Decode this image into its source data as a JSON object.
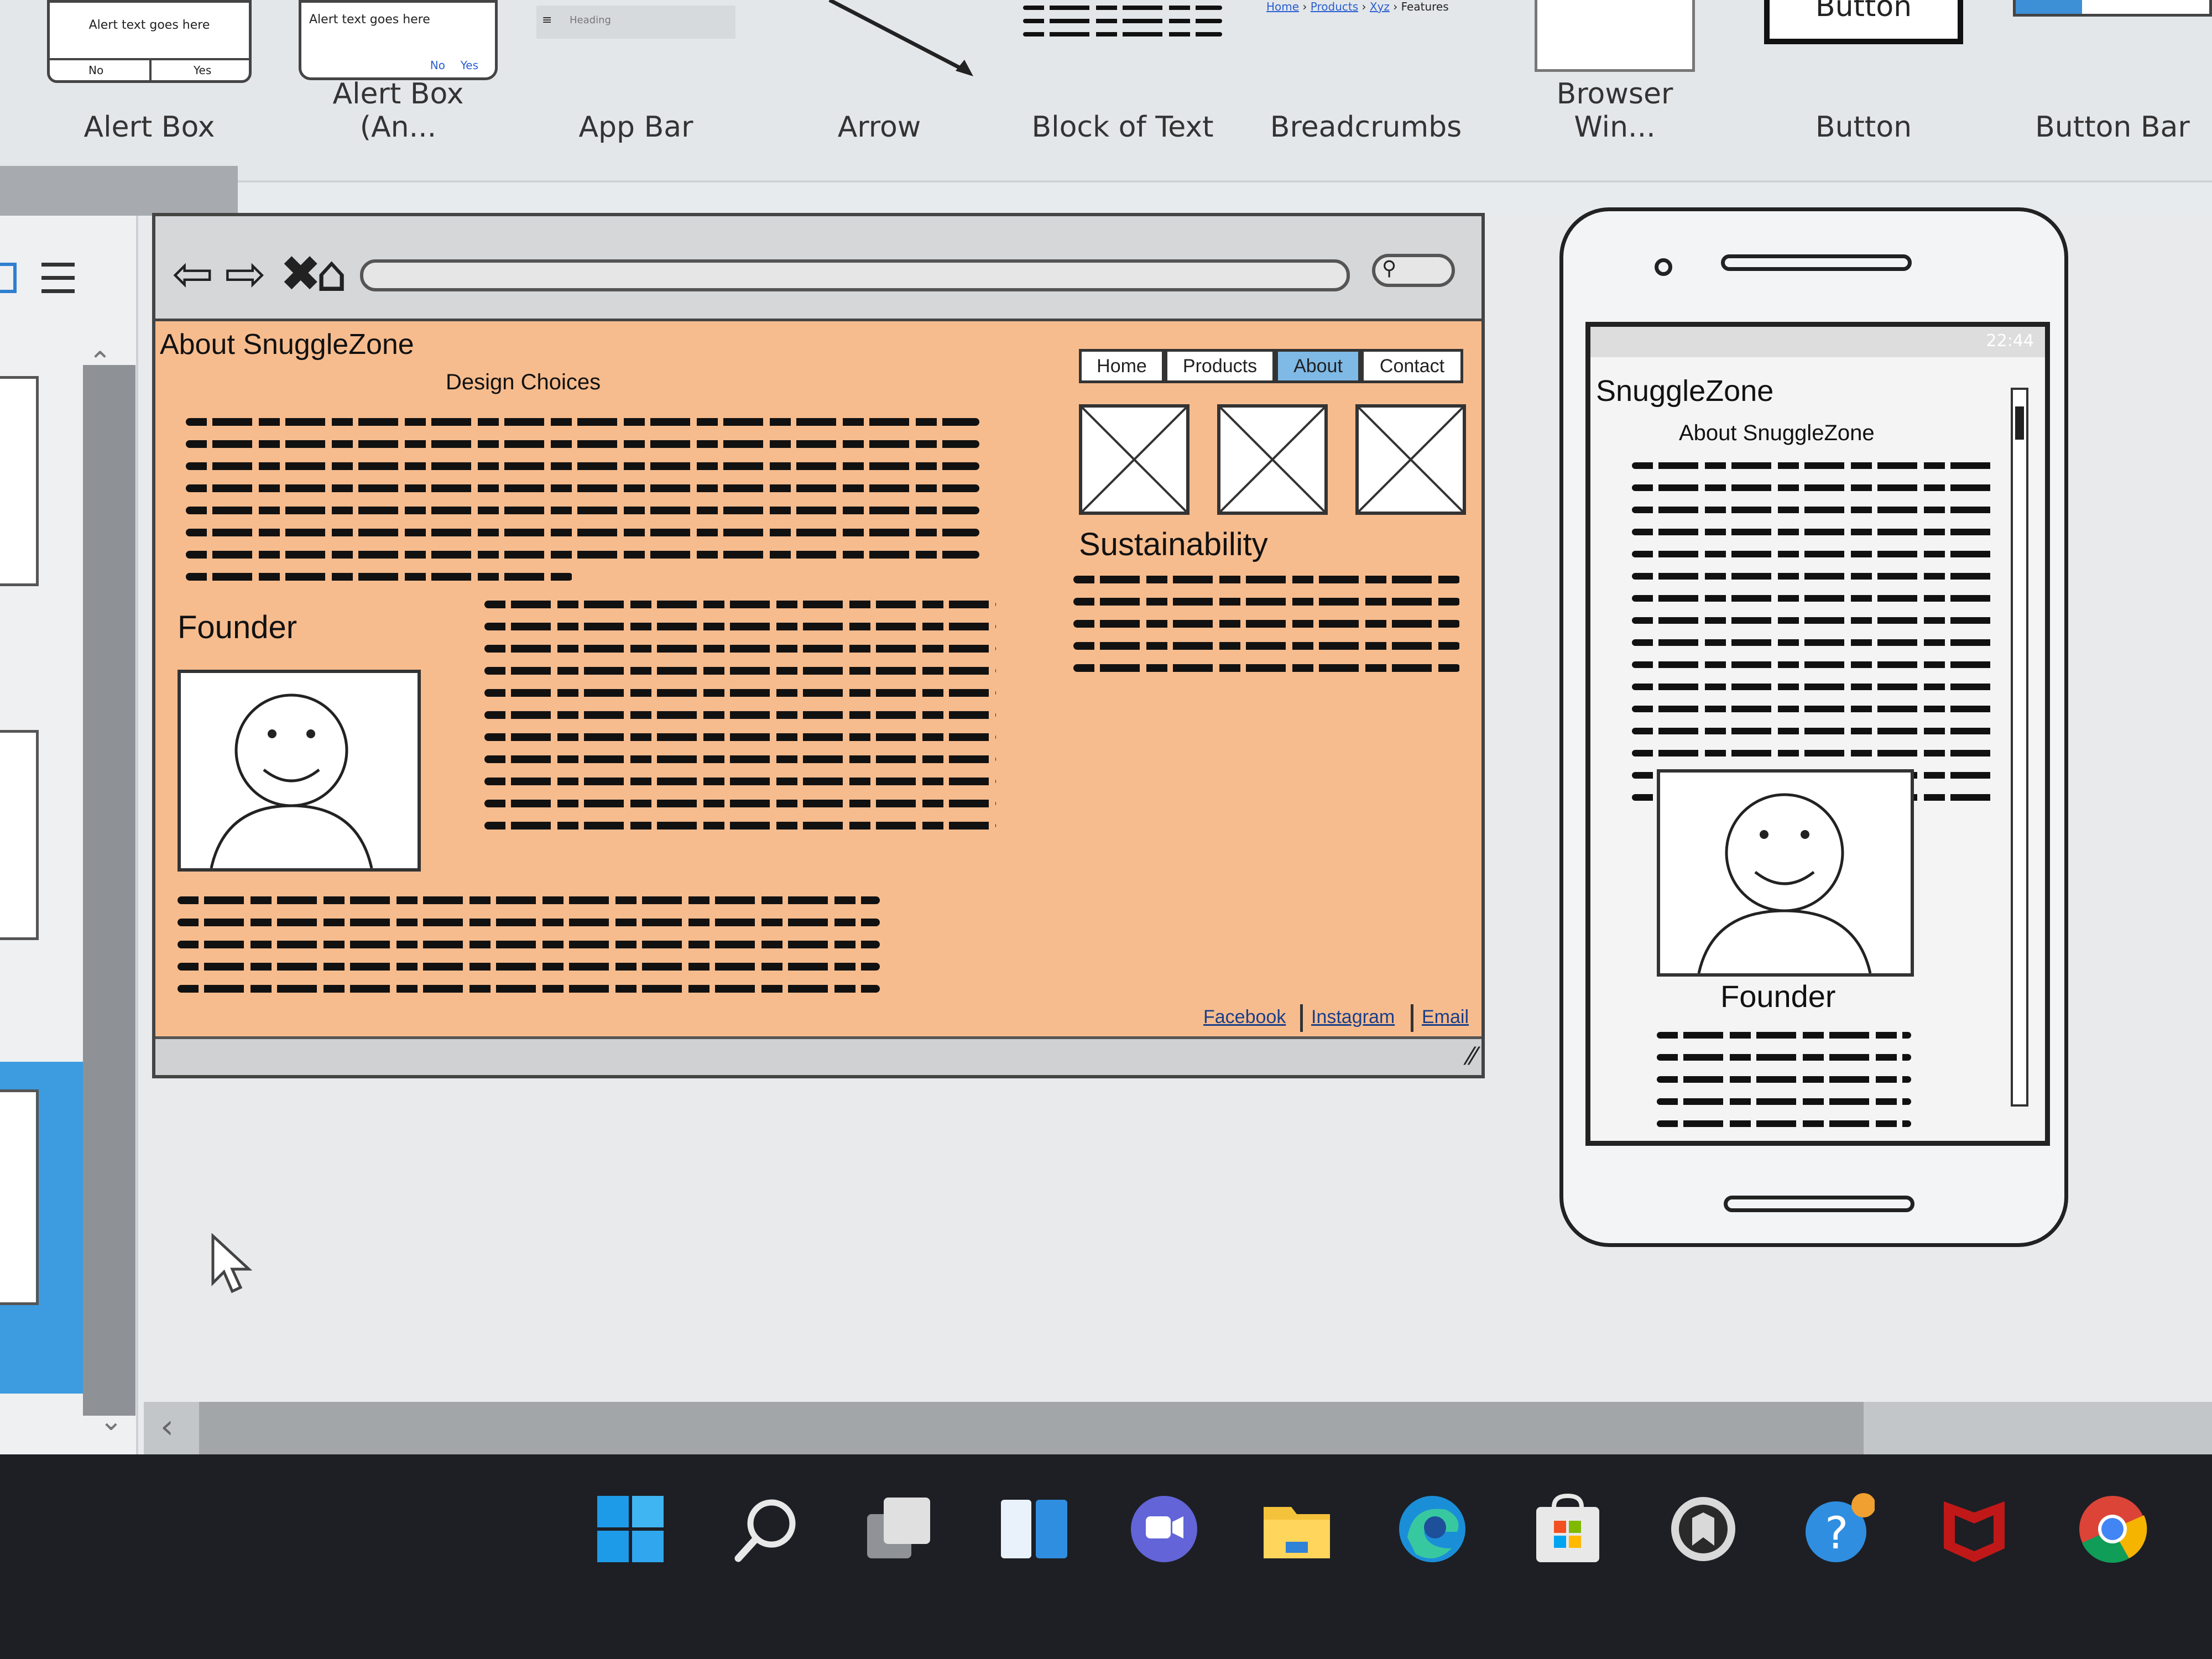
{
  "library": {
    "items": [
      {
        "label": "Alert Box",
        "thumb_text": "Alert text goes here",
        "no": "No",
        "yes": "Yes"
      },
      {
        "label": "Alert Box (An...",
        "thumb_text": "Alert text goes here",
        "no": "No",
        "yes": "Yes"
      },
      {
        "label": "App Bar",
        "thumb_text": "Heading"
      },
      {
        "label": "Arrow"
      },
      {
        "label": "Block of Text"
      },
      {
        "label": "Breadcrumbs",
        "crumbs": [
          "Home",
          "Products",
          "Xyz",
          "Features"
        ]
      },
      {
        "label": "Browser Win..."
      },
      {
        "label": "Button",
        "thumb_text": "Button"
      },
      {
        "label": "Button Bar"
      }
    ]
  },
  "browser_mockup": {
    "page_title": "About SnuggleZone",
    "subtitle": "Design Choices",
    "nav": [
      "Home",
      "Products",
      "About",
      "Contact"
    ],
    "active_nav": "About",
    "founder_heading": "Founder",
    "sustainability_heading": "Sustainability",
    "footer_links": [
      "Facebook",
      "Instagram",
      "Email"
    ]
  },
  "phone_mockup": {
    "status_time": "22:44",
    "title": "SnuggleZone",
    "subtitle": "About SnuggleZone",
    "founder_caption": "Founder"
  },
  "taskbar": {
    "icons": [
      "windows-start-icon",
      "search-icon",
      "task-view-icon",
      "widgets-icon",
      "teams-chat-icon",
      "file-explorer-icon",
      "edge-icon",
      "microsoft-store-icon",
      "app-icon",
      "help-icon",
      "mcafee-icon",
      "chrome-icon"
    ]
  },
  "colors": {
    "mockup_background": "#f7bc8e",
    "active_tab": "#7fb9e6",
    "taskbar": "#1d1f24"
  }
}
